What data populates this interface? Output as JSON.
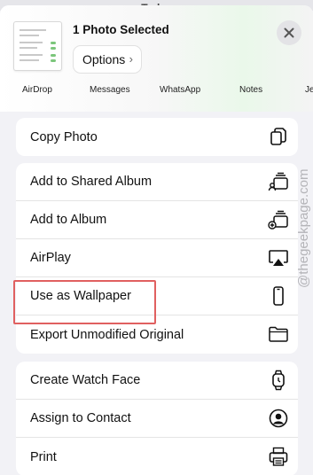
{
  "statusbar": {
    "text": "Today"
  },
  "header": {
    "title": "1 Photo Selected",
    "options_label": "Options",
    "options_chevron": "›",
    "close_icon": "close-icon"
  },
  "apps": [
    {
      "label": "AirDrop"
    },
    {
      "label": "Messages"
    },
    {
      "label": "WhatsApp"
    },
    {
      "label": "Notes"
    },
    {
      "label": "Je"
    }
  ],
  "groups": [
    {
      "items": [
        {
          "label": "Copy Photo",
          "icon": "copy-icon"
        }
      ]
    },
    {
      "items": [
        {
          "label": "Add to Shared Album",
          "icon": "shared-album-icon"
        },
        {
          "label": "Add to Album",
          "icon": "add-album-icon"
        },
        {
          "label": "AirPlay",
          "icon": "airplay-icon"
        },
        {
          "label": "Use as Wallpaper",
          "icon": "phone-icon"
        },
        {
          "label": "Export Unmodified Original",
          "icon": "folder-icon"
        }
      ]
    },
    {
      "items": [
        {
          "label": "Create Watch Face",
          "icon": "watch-icon"
        },
        {
          "label": "Assign to Contact",
          "icon": "contact-icon"
        },
        {
          "label": "Print",
          "icon": "printer-icon"
        }
      ]
    }
  ],
  "watermark": "@thegeekpage.com",
  "colors": {
    "highlight": "#e06060",
    "background": "#f2f2f6"
  }
}
